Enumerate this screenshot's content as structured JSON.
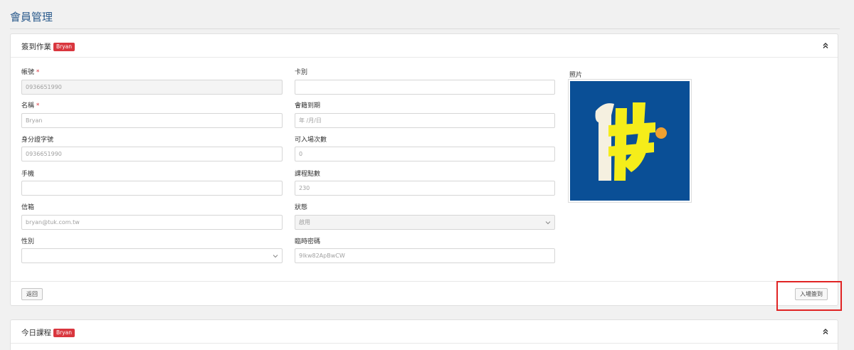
{
  "page": {
    "title": "會員管理"
  },
  "checkin_panel": {
    "title": "簽到作業",
    "badge": "Bryan",
    "fields_left": {
      "account": {
        "label": "帳號",
        "required": "*",
        "value": "0936651990"
      },
      "name": {
        "label": "名稱",
        "required": "*",
        "value": "Bryan"
      },
      "id_number": {
        "label": "身分證字號",
        "value": "0936651990"
      },
      "mobile": {
        "label": "手機",
        "value": ""
      },
      "email": {
        "label": "信箱",
        "value": "bryan@tuk.com.tw"
      },
      "gender": {
        "label": "性別",
        "value": ""
      }
    },
    "fields_right": {
      "card_type": {
        "label": "卡別",
        "value": ""
      },
      "membership_expiry": {
        "label": "會籍到期",
        "placeholder": "年 /月/日"
      },
      "entries_remaining": {
        "label": "可入場次數",
        "value": "0"
      },
      "course_points": {
        "label": "課程點數",
        "value": "230"
      },
      "status": {
        "label": "狀態",
        "value": "啟用"
      },
      "temp_password": {
        "label": "臨時密碼",
        "value": "9lkw82ApBwCW"
      }
    },
    "photo": {
      "label": "照片",
      "logo_colors": {
        "background": "#0a4f96",
        "figure": "#f5f0e0",
        "accent": "#f5ed1a",
        "dot": "#f0a030"
      }
    },
    "footer": {
      "back_label": "返回",
      "checkin_label": "入場簽到"
    }
  },
  "today_course_panel": {
    "title": "今日課程",
    "badge": "Bryan"
  },
  "colors": {
    "title": "#2a5a8c",
    "badge": "#d9363e",
    "highlight": "#e02424"
  }
}
